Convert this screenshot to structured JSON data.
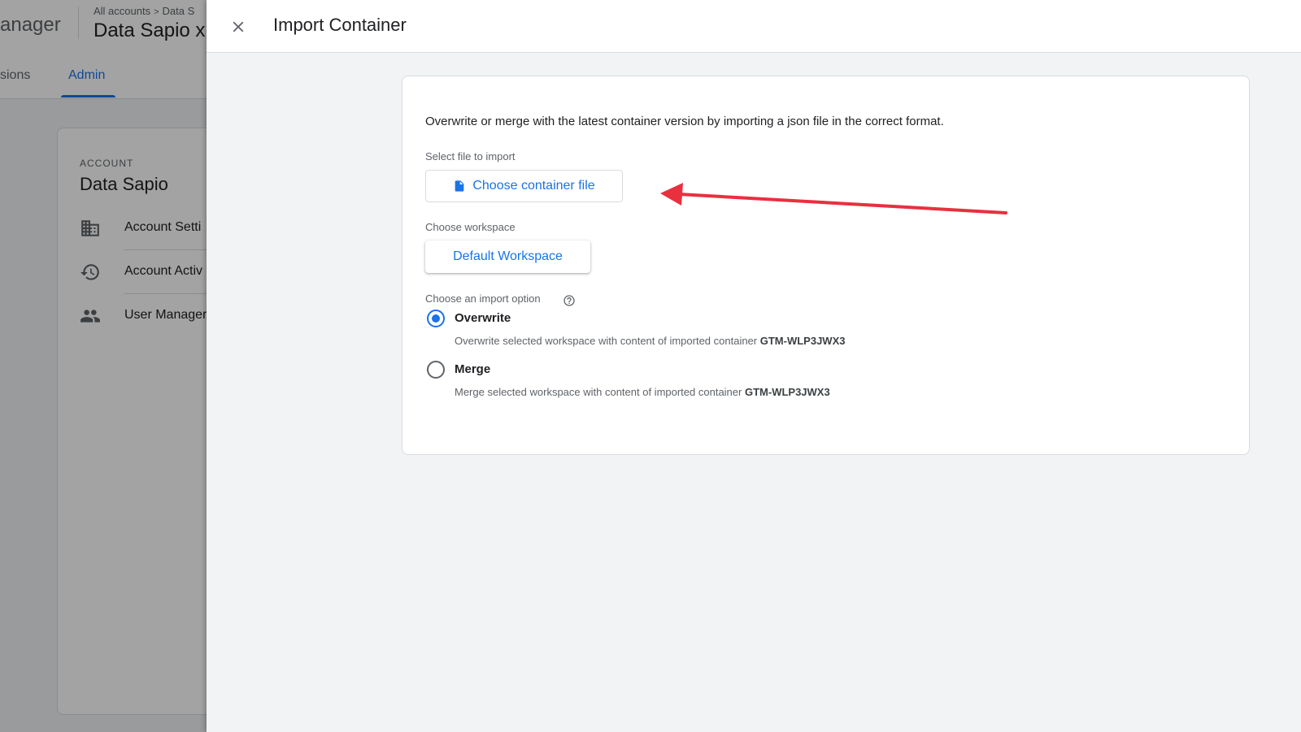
{
  "background": {
    "product_fragment": "anager",
    "breadcrumb": {
      "all_accounts": "All accounts",
      "separator": ">",
      "current": "Data S"
    },
    "container_name": "Data Sapio x",
    "tabs": [
      {
        "label": "sions"
      },
      {
        "label": "Admin",
        "active": true
      }
    ],
    "account_card": {
      "overline": "ACCOUNT",
      "title": "Data Sapio",
      "items": [
        {
          "label": "Account Setti",
          "icon": "building-icon"
        },
        {
          "label": "Account Activ",
          "icon": "history-icon"
        },
        {
          "label": "User Manager",
          "icon": "people-icon"
        }
      ]
    }
  },
  "panel": {
    "title": "Import Container",
    "close_icon": "close-icon",
    "intro": "Overwrite or merge with the latest container version by importing a json file in the correct format.",
    "file": {
      "label": "Select file to import",
      "button": "Choose container file",
      "icon": "file-icon"
    },
    "workspace": {
      "label": "Choose workspace",
      "button": "Default Workspace"
    },
    "import_option": {
      "label": "Choose an import option",
      "help_icon": "help-icon",
      "options": [
        {
          "label": "Overwrite",
          "description": "Overwrite selected workspace with content of imported container",
          "container_id": "GTM-WLP3JWX3",
          "selected": true
        },
        {
          "label": "Merge",
          "description": "Merge selected workspace with content of imported container",
          "container_id": "GTM-WLP3JWX3",
          "selected": false
        }
      ]
    }
  },
  "annotation": {
    "arrow_color": "#e8303f"
  },
  "colors": {
    "accent": "#1a73e8",
    "panel_bg": "#f1f3f4",
    "text": "#202124",
    "muted": "#5f6368"
  }
}
